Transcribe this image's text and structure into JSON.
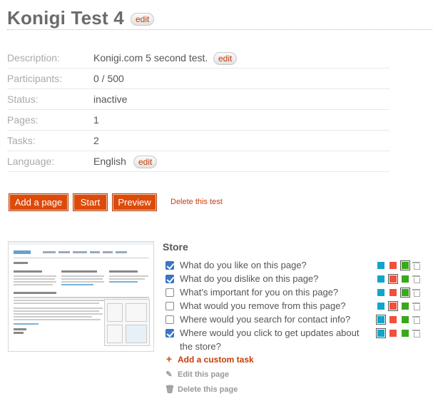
{
  "header": {
    "title": "Konigi Test 4",
    "edit_label": "edit"
  },
  "info": [
    {
      "label": "Description:",
      "value": "Konigi.com 5 second test.",
      "editable": true,
      "edit_label": "edit"
    },
    {
      "label": "Participants:",
      "value": "0 / 500",
      "editable": false
    },
    {
      "label": "Status:",
      "value": "inactive",
      "editable": false
    },
    {
      "label": "Pages:",
      "value": "1",
      "editable": false
    },
    {
      "label": "Tasks:",
      "value": "2",
      "editable": false
    },
    {
      "label": "Language:",
      "value": "English",
      "editable": true,
      "edit_label": "edit"
    }
  ],
  "actions": {
    "add_page": "Add a page",
    "start": "Start",
    "preview": "Preview",
    "delete_test": "Delete this test"
  },
  "page": {
    "name": "Store",
    "tasks": [
      {
        "question": "What do you like on this page?",
        "checked": true,
        "selected_color": "green"
      },
      {
        "question": "What do you dislike on this page?",
        "checked": true,
        "selected_color": "red"
      },
      {
        "question": "What's important for you on this page?",
        "checked": false,
        "selected_color": "green"
      },
      {
        "question": "What would you remove from this page?",
        "checked": false,
        "selected_color": "red"
      },
      {
        "question": "Where would you search for contact info?",
        "checked": false,
        "selected_color": "blue"
      },
      {
        "question": "Where would you click to get updates about the store?",
        "checked": true,
        "selected_color": "blue"
      }
    ],
    "add_custom_task": "Add a custom task",
    "edit_page": "Edit this page",
    "delete_page": "Delete this page"
  },
  "colors": {
    "blue": "#12a5c9",
    "red": "#f0503c",
    "green": "#3aa81c",
    "accent": "#dd4b0a"
  },
  "icons": {
    "add": "plus-icon",
    "edit": "pencil-icon",
    "delete": "trash-icon"
  }
}
